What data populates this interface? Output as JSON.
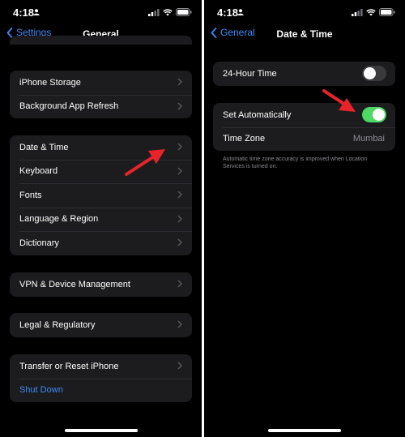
{
  "colors": {
    "accent_blue": "#3e8bf6",
    "toggle_on": "#4cd964",
    "toggle_off": "#3a3a3c",
    "cell_bg": "#1c1c1e",
    "background": "#000000",
    "arrow_red": "#e8242a"
  },
  "left": {
    "status_time": "4:18",
    "back_label": "Settings",
    "title": "General",
    "groups": [
      {
        "items": [
          "iPhone Storage",
          "Background App Refresh"
        ]
      },
      {
        "items": [
          "Date & Time",
          "Keyboard",
          "Fonts",
          "Language & Region",
          "Dictionary"
        ]
      },
      {
        "items": [
          "VPN & Device Management"
        ]
      },
      {
        "items": [
          "Legal & Regulatory"
        ]
      },
      {
        "items": [
          "Transfer or Reset iPhone",
          "Shut Down"
        ]
      }
    ]
  },
  "right": {
    "status_time": "4:18",
    "back_label": "General",
    "title": "Date & Time",
    "hour24": {
      "label": "24-Hour Time",
      "enabled": false
    },
    "auto": {
      "label": "Set Automatically",
      "enabled": true
    },
    "timezone": {
      "label": "Time Zone",
      "value": "Mumbai"
    },
    "footnote": "Automatic time zone accuracy is improved when Location Services is turned on."
  },
  "icons": {
    "status": [
      "person-icon",
      "signal-icon",
      "wifi-icon",
      "battery-icon"
    ],
    "back": "chevron-left-icon",
    "disclosure": "chevron-right-icon",
    "annotation": "red-arrow-icon"
  }
}
